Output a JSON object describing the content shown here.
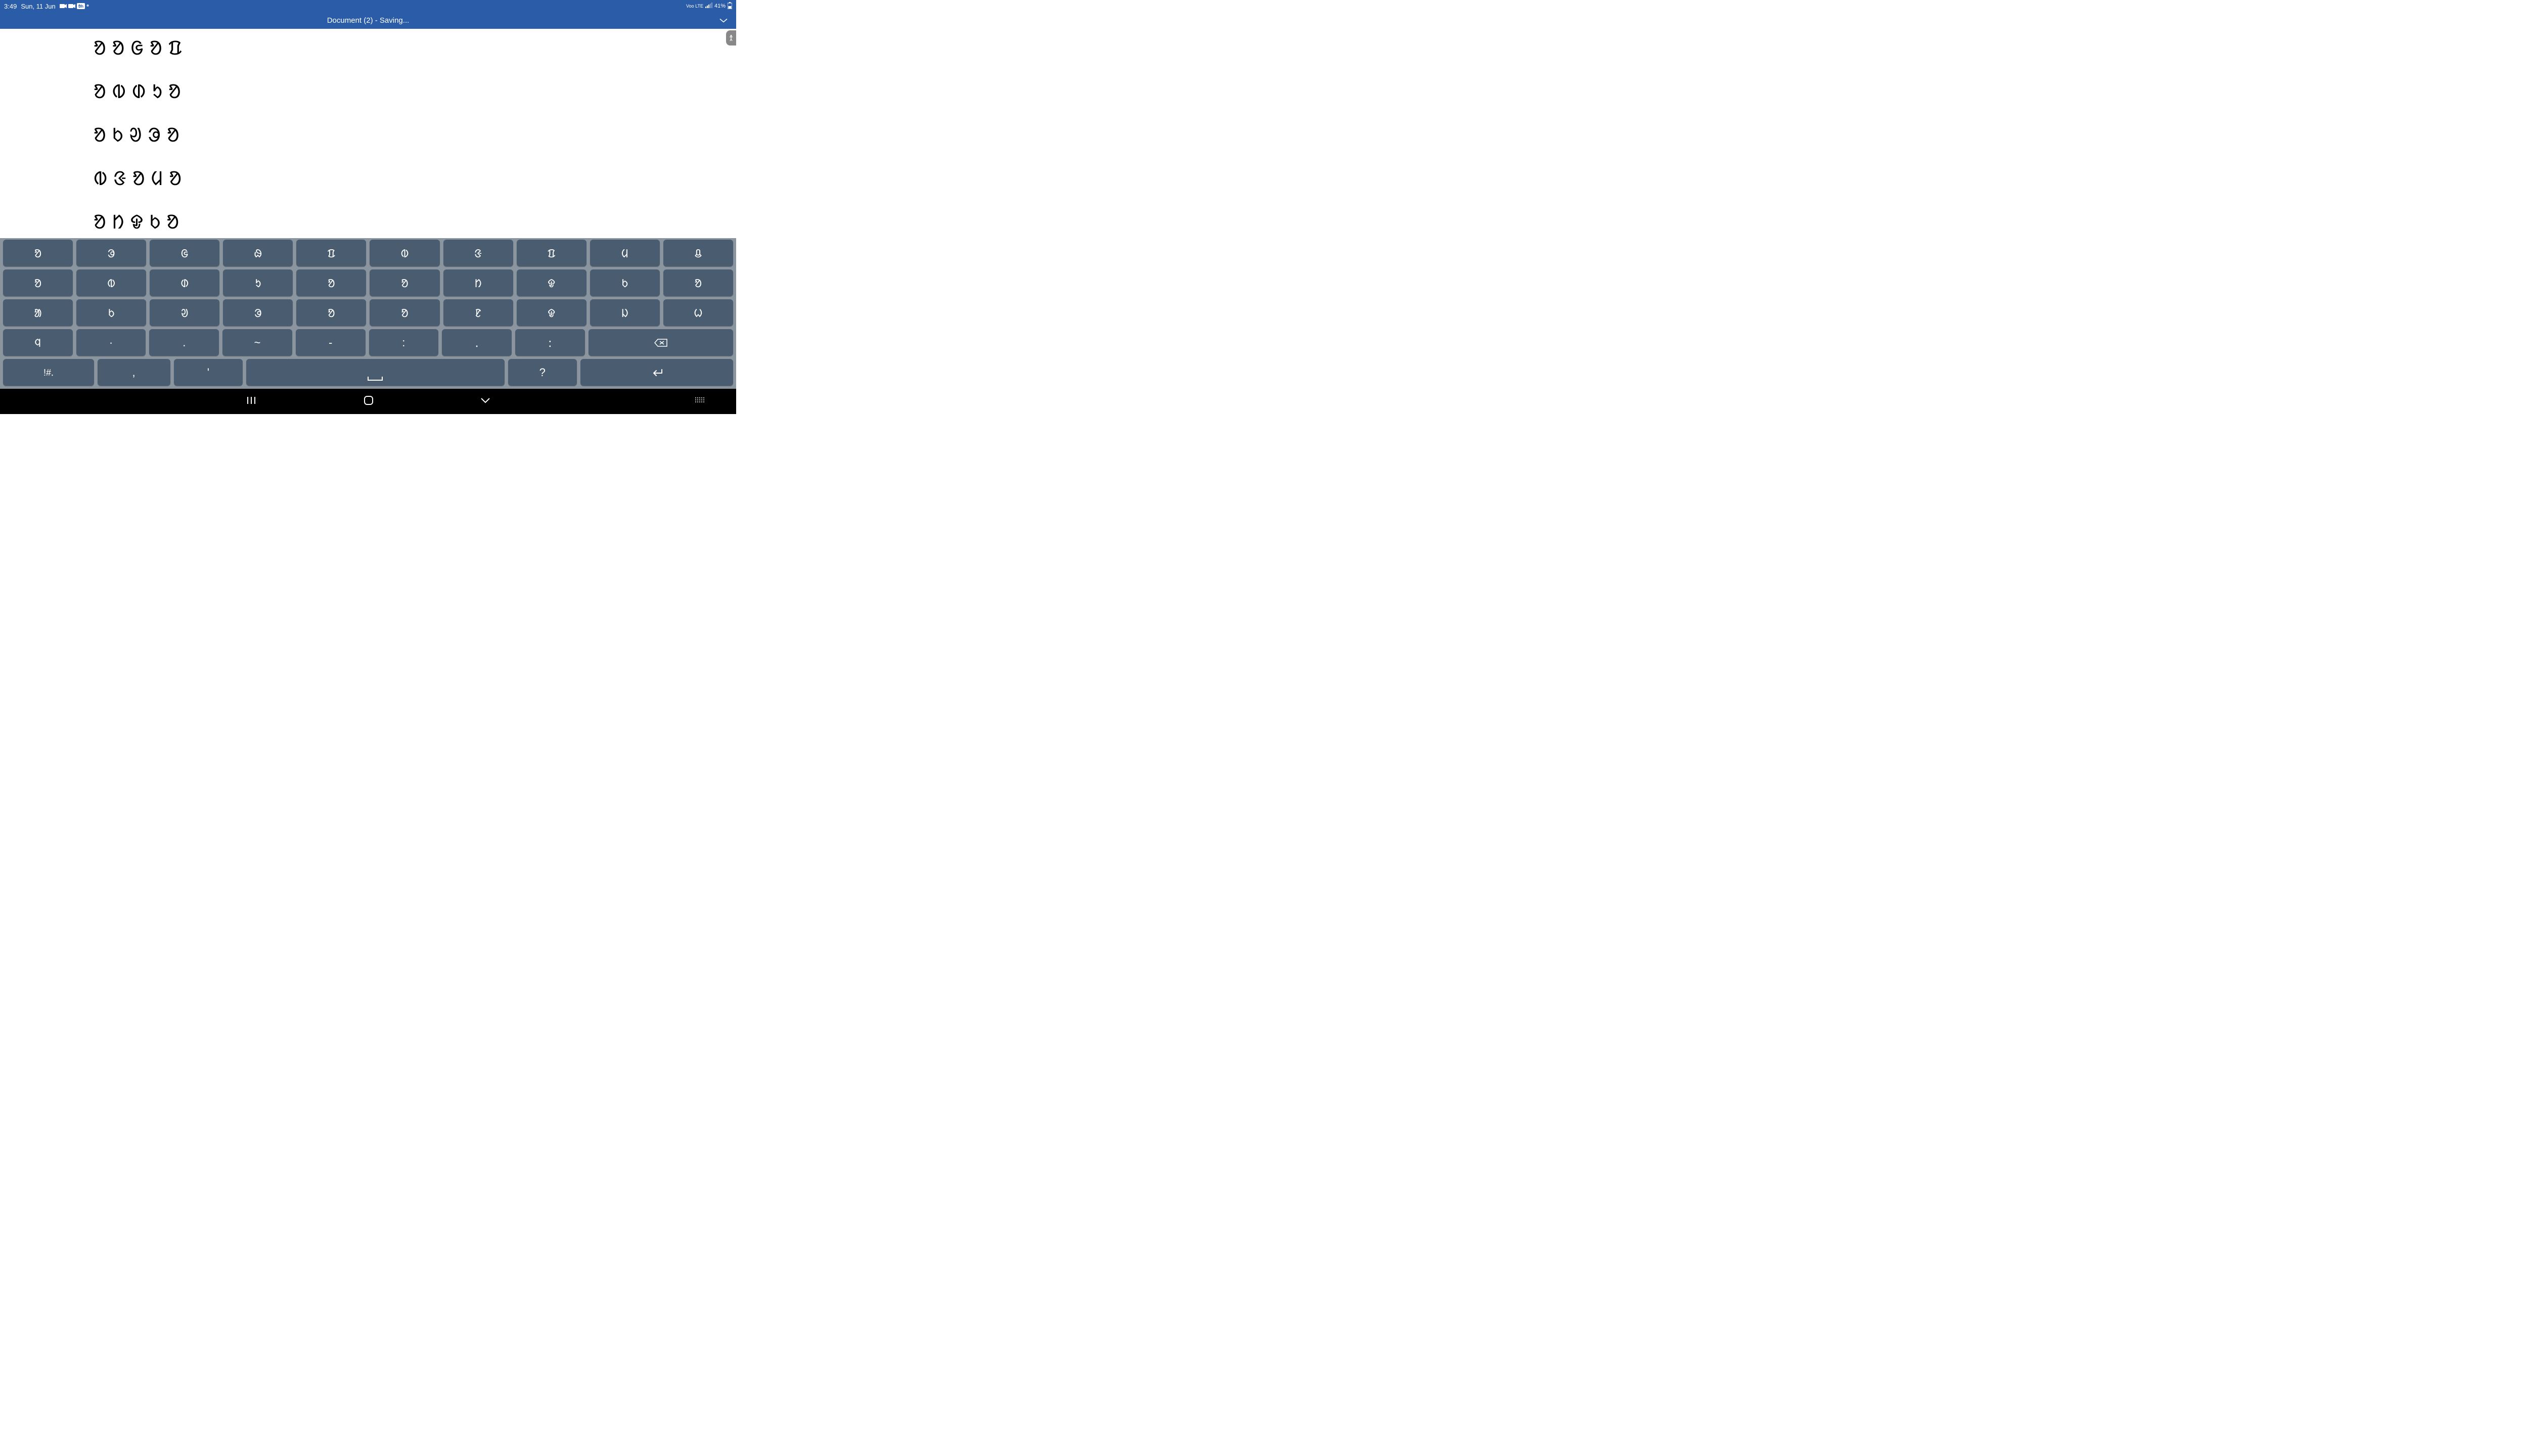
{
  "status_bar": {
    "time": "3:49",
    "date": "Sun, 11 Jun",
    "network_label": "Voo LTE",
    "battery": "41%"
  },
  "app_bar": {
    "title": "Document (2) - Saving..."
  },
  "document": {
    "lines": [
      "ᱚᱚᱜᱚᱯ",
      "ᱚᱵᱰᱩᱚ",
      "ᱚᱠᱣᱳᱚ",
      "ᱵᱝᱚᱢᱚ",
      "ᱚᱴᱫᱠᱚ"
    ]
  },
  "keyboard": {
    "row1": [
      "ᱚ",
      "ᱳ",
      "ᱜ",
      "ᱷ",
      "ᱯ",
      "ᱵ",
      "ᱝ",
      "ᱯ",
      "ᱢ",
      "ᱪ"
    ],
    "row2": [
      "ᱚ",
      "ᱵ",
      "ᱰ",
      "ᱩ",
      "ᱚ",
      "ᱚ",
      "ᱴ",
      "ᱫ",
      "ᱠ",
      "ᱚ"
    ],
    "row3": [
      "ᱟ",
      "ᱠ",
      "ᱣ",
      "ᱳ",
      "ᱚ",
      "ᱚ",
      "ᱱ",
      "ᱫ",
      "ᱡ",
      "ᱦ"
    ],
    "row4": [
      "ᱧ",
      "·",
      ".",
      "~",
      "-",
      ":",
      "ᱹ",
      "ᱺ"
    ],
    "row5_symbols": "!#ᱹ",
    "row5_comma": ",",
    "row5_apostrophe": "'",
    "row5_question": "?"
  }
}
